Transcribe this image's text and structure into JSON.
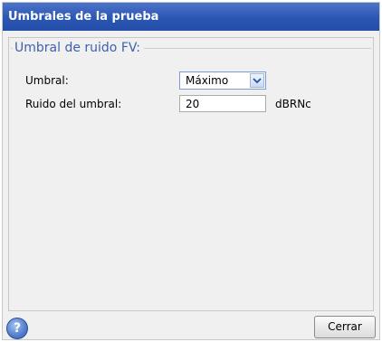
{
  "window": {
    "title": "Umbrales de la prueba"
  },
  "group": {
    "title": "Umbral de ruido FV:"
  },
  "fields": {
    "threshold_label": "Umbral:",
    "threshold_value": "Máximo",
    "noise_label": "Ruido del umbral:",
    "noise_value": "20",
    "noise_unit": "dBRNc"
  },
  "footer": {
    "help_icon": "question-mark-icon",
    "help_glyph": "?",
    "close_label": "Cerrar"
  },
  "colors": {
    "titlebar": "#2b56b3",
    "group_title": "#3f5fae"
  }
}
